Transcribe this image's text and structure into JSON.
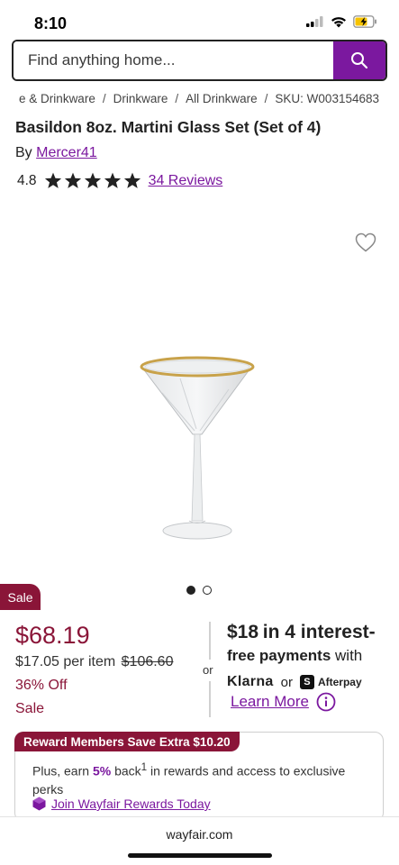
{
  "status_bar": {
    "time": "8:10"
  },
  "search": {
    "placeholder": "Find anything home..."
  },
  "breadcrumb": [
    "e & Drinkware",
    "Drinkware",
    "All Drinkware",
    "SKU: W003154683"
  ],
  "product": {
    "title": "Basildon 8oz. Martini Glass Set (Set of 4)",
    "by_label": "By",
    "brand": "Mercer41",
    "rating": "4.8",
    "stars": 4.8,
    "reviews": "34 Reviews"
  },
  "badge": "Sale",
  "pricing": {
    "price": "$68.19",
    "per_item": "$17.05 per item",
    "original": "$106.60",
    "percent_off": "36% Off",
    "sale_label": "Sale"
  },
  "payments": {
    "or": "or",
    "amount": "$18",
    "line1_rest": "in 4 interest-",
    "line2_bold": "free payments",
    "line2_rest": "with",
    "klarna": "Klarna",
    "or_small": "or",
    "afterpay_icon": "S",
    "afterpay": "Afterpay",
    "learn_more": "Learn More"
  },
  "rewards": {
    "tag": "Reward Members Save Extra $10.20",
    "text_pre": "Plus, earn",
    "percent": "5%",
    "text_back": "back",
    "sup": "1",
    "text_post": "in rewards and access to exclusive perks",
    "link": "Join Wayfair Rewards Today"
  },
  "browser": {
    "url": "wayfair.com"
  },
  "colors": {
    "brand_purple": "#7b189f",
    "sale_red": "#8a1538"
  }
}
